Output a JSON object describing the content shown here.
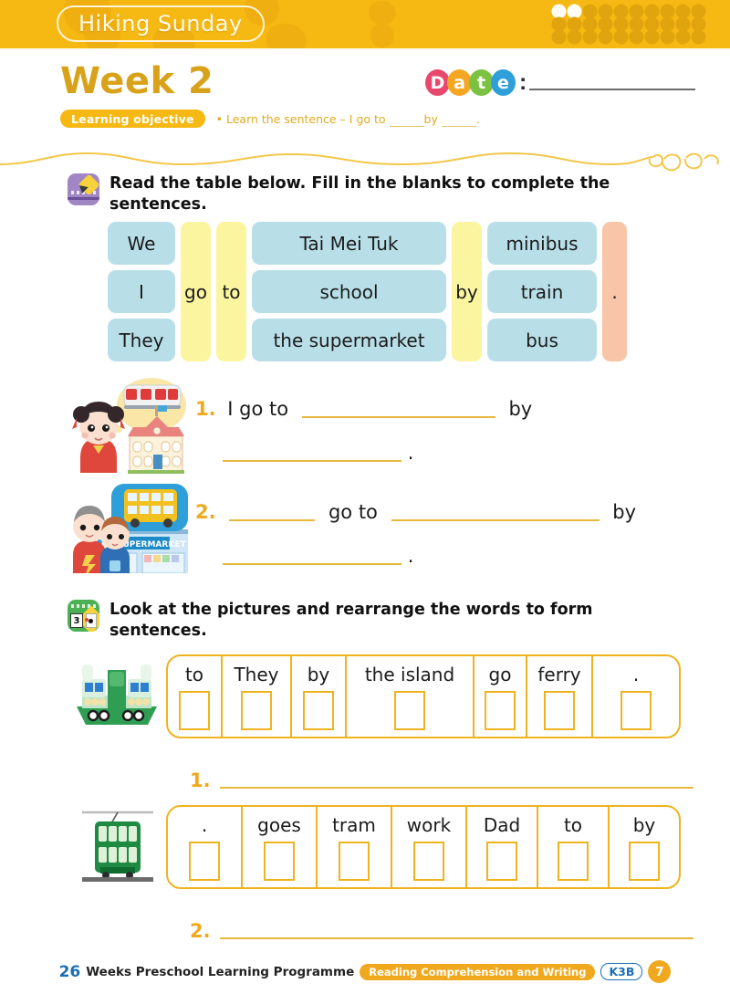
{
  "header": {
    "theme_title": "Hiking Sunday",
    "banner_color": "#f6b812"
  },
  "week": {
    "title": "Week 2",
    "date_label_letters": [
      "D",
      "a",
      "t",
      "e"
    ],
    "date_letter_colors": [
      "#e8486d",
      "#f5a623",
      "#7cc242",
      "#2f9fd9"
    ],
    "date_colon": ":"
  },
  "learning_objective": {
    "badge": "Learning objective",
    "bullet": "•",
    "text_before": "Learn the sentence – I go to",
    "text_middle": "by",
    "text_end": "."
  },
  "section1": {
    "icon": "pencil-icon",
    "instruction": "Read the table below. Fill in the blanks to complete the sentences."
  },
  "table": {
    "col_subject": [
      "We",
      "I",
      "They"
    ],
    "col_go": "go",
    "col_to": "to",
    "col_place": [
      "Tai Mei Tuk",
      "school",
      "the supermarket"
    ],
    "col_by": "by",
    "col_transport": [
      "minibus",
      "train",
      "bus"
    ],
    "col_period": ".",
    "colors": {
      "cell": "#b8dfe8",
      "yellow": "#fbf5a0",
      "salmon": "#f8c5a8"
    }
  },
  "fill_blanks": [
    {
      "number": "1.",
      "illustration": "girl-train-school-icon",
      "line1_a": "I go to",
      "line1_b": "by",
      "line2_end": "."
    },
    {
      "number": "2.",
      "illustration": "boys-bus-supermarket-icon",
      "line1_a": "go to",
      "line1_b": "by",
      "line2_end": "."
    }
  ],
  "section2": {
    "icon": "cards-number-icon",
    "instruction": "Look at the pictures and rearrange the words to form sentences."
  },
  "rearrange": [
    {
      "illustration": "ferry-icon",
      "words": [
        "to",
        "They",
        "by",
        "the island",
        "go",
        "ferry",
        "."
      ],
      "widths": [
        60,
        76,
        60,
        140,
        58,
        72,
        58
      ],
      "answer_number": "1."
    },
    {
      "illustration": "tram-icon",
      "words": [
        ".",
        "goes",
        "tram",
        "work",
        "Dad",
        "to",
        "by"
      ],
      "widths": [
        74,
        78,
        78,
        78,
        74,
        74,
        74
      ],
      "answer_number": "2."
    }
  ],
  "footer": {
    "number": "26",
    "programme": "Weeks Preschool Learning Programme",
    "subject": "Reading Comprehension and Writing",
    "level": "K3B",
    "page": "7"
  }
}
